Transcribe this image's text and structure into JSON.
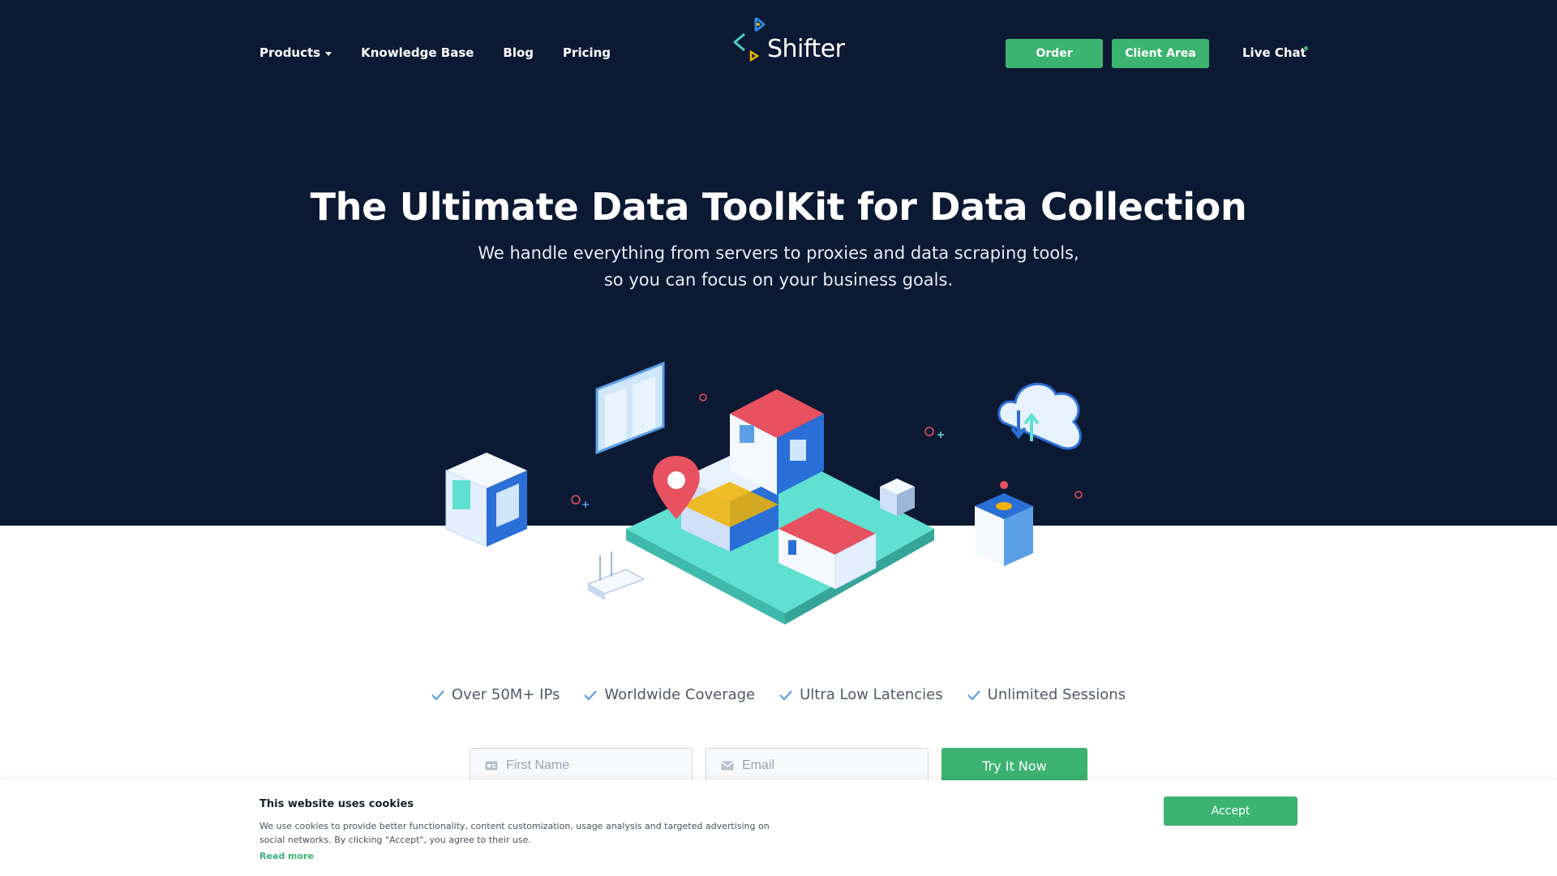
{
  "nav": {
    "links": [
      {
        "label": "Products"
      },
      {
        "label": "Knowledge Base"
      },
      {
        "label": "Blog"
      },
      {
        "label": "Pricing"
      }
    ],
    "logo_text": "Shifter",
    "order_label": "Order",
    "client_area_label": "Client Area",
    "live_chat_label": "Live Chat"
  },
  "hero": {
    "title": "The Ultimate Data ToolKit for Data Collection",
    "subtitle_line1": "We handle everything from servers to proxies and data scraping tools,",
    "subtitle_line2": "so you can focus on your business goals."
  },
  "features": [
    {
      "label": "Over 50M+ IPs",
      "icon": "check-icon"
    },
    {
      "label": "Worldwide Coverage",
      "icon": "check-icon"
    },
    {
      "label": "Ultra Low Latencies",
      "icon": "check-icon"
    },
    {
      "label": "Unlimited Sessions",
      "icon": "check-icon"
    }
  ],
  "signup": {
    "first_name_placeholder": "First Name",
    "email_placeholder": "Email",
    "submit_label": "Try It Now"
  },
  "cookie": {
    "title": "This website uses cookies",
    "text": "We use cookies to provide better functionality, content customization, usage analysis and targeted advertising on social networks. By clicking \"Accept\", you agree to their use.",
    "read_more": "Read more",
    "accept_label": "Accept"
  },
  "colors": {
    "hero_bg": "#0c1933",
    "accent_green": "#3cb371",
    "teal": "#5fe0d1",
    "red": "#e8515f",
    "blue": "#2a6fd8"
  }
}
